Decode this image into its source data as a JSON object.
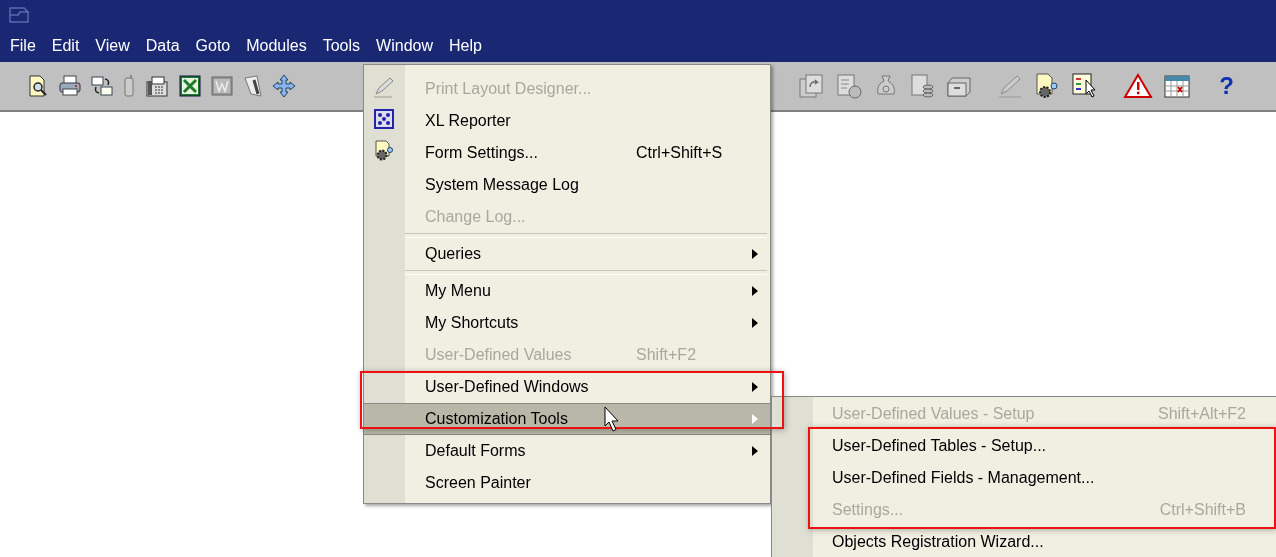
{
  "menubar": [
    {
      "label": "File"
    },
    {
      "label": "Edit"
    },
    {
      "label": "View"
    },
    {
      "label": "Data"
    },
    {
      "label": "Goto"
    },
    {
      "label": "Modules"
    },
    {
      "label": "Tools"
    },
    {
      "label": "Window"
    },
    {
      "label": "Help"
    }
  ],
  "toolbar": {
    "help": "?"
  },
  "tools_menu": [
    {
      "kind": "item",
      "label": "Print Layout Designer...",
      "disabled": true,
      "selected": false,
      "submenu": false
    },
    {
      "kind": "item",
      "label": "XL Reporter",
      "disabled": false,
      "selected": false,
      "submenu": false
    },
    {
      "kind": "item",
      "label": "Form Settings...",
      "shortcut": "Ctrl+Shift+S",
      "disabled": false,
      "selected": false,
      "submenu": false
    },
    {
      "kind": "item",
      "label": "System Message Log",
      "disabled": false,
      "selected": false,
      "submenu": false
    },
    {
      "kind": "item",
      "label": "Change Log...",
      "disabled": true,
      "selected": false,
      "submenu": false
    },
    {
      "kind": "separator"
    },
    {
      "kind": "item",
      "label": "Queries",
      "disabled": false,
      "selected": false,
      "submenu": true
    },
    {
      "kind": "separator"
    },
    {
      "kind": "item",
      "label": "My Menu",
      "disabled": false,
      "selected": false,
      "submenu": true
    },
    {
      "kind": "item",
      "label": "My Shortcuts",
      "disabled": false,
      "selected": false,
      "submenu": true
    },
    {
      "kind": "item",
      "label": "User-Defined Values",
      "shortcut": "Shift+F2",
      "disabled": true,
      "selected": false,
      "submenu": false
    },
    {
      "kind": "item",
      "label": "User-Defined Windows",
      "disabled": false,
      "selected": false,
      "submenu": true
    },
    {
      "kind": "item",
      "label": "Customization Tools",
      "disabled": false,
      "selected": true,
      "submenu": true
    },
    {
      "kind": "item",
      "label": "Default Forms",
      "disabled": false,
      "selected": false,
      "submenu": true
    },
    {
      "kind": "item",
      "label": "Screen Painter",
      "disabled": false,
      "selected": false,
      "submenu": false
    }
  ],
  "customization_submenu": [
    {
      "label": "User-Defined Values - Setup",
      "shortcut": "Shift+Alt+F2",
      "disabled": true
    },
    {
      "label": "User-Defined Tables - Setup...",
      "disabled": false
    },
    {
      "label": "User-Defined Fields - Management...",
      "disabled": false
    },
    {
      "label": "Settings...",
      "shortcut": "Ctrl+Shift+B",
      "disabled": true
    },
    {
      "label": "Objects Registration Wizard...",
      "disabled": false
    }
  ]
}
